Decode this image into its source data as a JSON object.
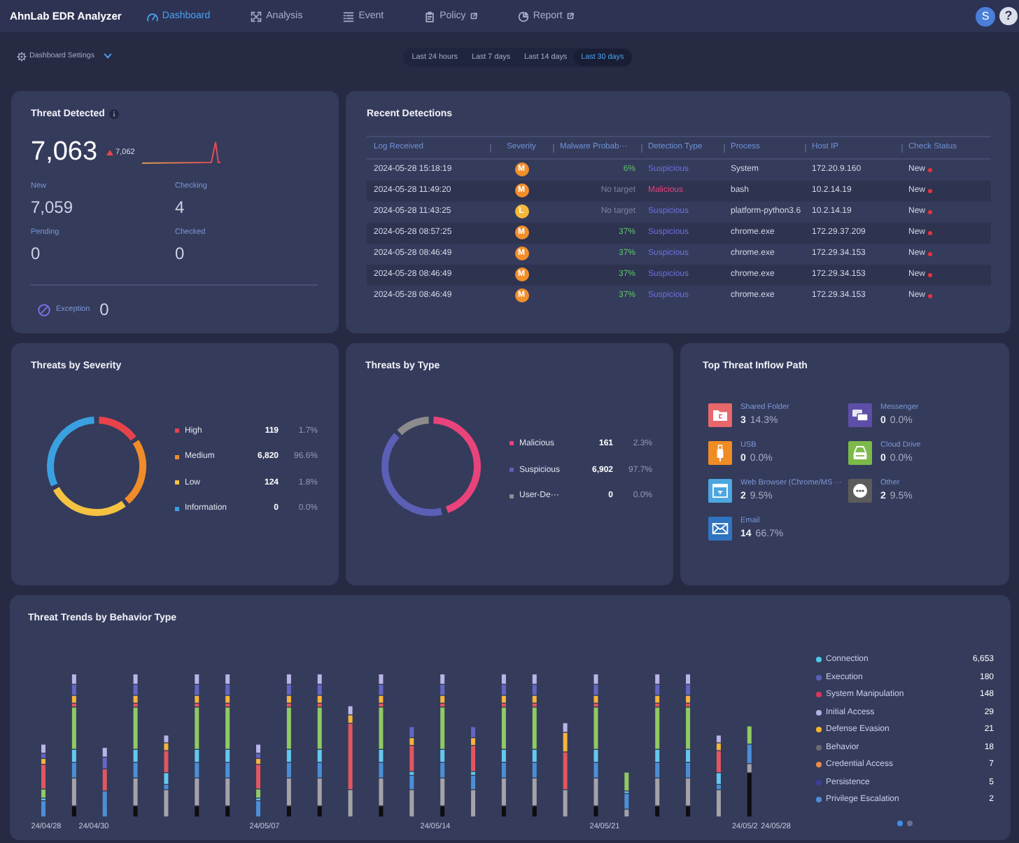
{
  "header": {
    "logo": "AhnLab EDR Analyzer",
    "nav": [
      {
        "label": "Dashboard",
        "kind": "gauge",
        "selected": true,
        "external": false
      },
      {
        "label": "Analysis",
        "kind": "arrows",
        "selected": false,
        "external": false
      },
      {
        "label": "Event",
        "kind": "list",
        "selected": false,
        "external": false
      },
      {
        "label": "Policy",
        "kind": "clipboard",
        "selected": false,
        "external": true
      },
      {
        "label": "Report",
        "kind": "pie",
        "selected": false,
        "external": true
      }
    ],
    "avatar": "S",
    "help": "?"
  },
  "toolbar": {
    "settings": "Dashboard Settings",
    "ranges": [
      {
        "label": "Last 24 hours",
        "selected": false
      },
      {
        "label": "Last 7 days",
        "selected": false
      },
      {
        "label": "Last 14 days",
        "selected": false
      },
      {
        "label": "Last 30 days",
        "selected": true
      }
    ]
  },
  "threat_detected": {
    "title": "Threat Detected",
    "total": "7,063",
    "increased": true,
    "previous": "7,062",
    "stats": [
      {
        "label": "New",
        "value": "7,059"
      },
      {
        "label": "Checking",
        "value": "4"
      },
      {
        "label": "Pending",
        "value": "0"
      },
      {
        "label": "Checked",
        "value": "0"
      }
    ],
    "exception": {
      "label": "Exception",
      "value": "0"
    }
  },
  "recent_detections": {
    "title": "Recent Detections",
    "columns": [
      "Log Received",
      "Severity",
      "Malware Probab···",
      "Detection Type",
      "Process",
      "Host IP",
      "Check Status"
    ],
    "rows": [
      {
        "log_received": "2024-05-28 15:18:19",
        "severity": {
          "letter": "M",
          "color": "#f28f2c"
        },
        "malware_probability": {
          "text": "6%",
          "kind": "percent"
        },
        "detection_type": {
          "text": "Suspicious",
          "kind": "suspicious"
        },
        "process": "System",
        "host_ip": "172.20.9.160",
        "check_status": {
          "text": "New",
          "alert": true
        }
      },
      {
        "log_received": "2024-05-28 11:49:20",
        "severity": {
          "letter": "M",
          "color": "#f28f2c"
        },
        "malware_probability": {
          "text": "No target",
          "kind": "none"
        },
        "detection_type": {
          "text": "Malicious",
          "kind": "malicious"
        },
        "process": "bash",
        "host_ip": "10.2.14.19",
        "check_status": {
          "text": "New",
          "alert": true
        }
      },
      {
        "log_received": "2024-05-28 11:43:25",
        "severity": {
          "letter": "L",
          "color": "#f5b83a"
        },
        "malware_probability": {
          "text": "No target",
          "kind": "none"
        },
        "detection_type": {
          "text": "Suspicious",
          "kind": "suspicious"
        },
        "process": "platform-python3.6",
        "host_ip": "10.2.14.19",
        "check_status": {
          "text": "New",
          "alert": true
        }
      },
      {
        "log_received": "2024-05-28 08:57:25",
        "severity": {
          "letter": "M",
          "color": "#f28f2c"
        },
        "malware_probability": {
          "text": "37%",
          "kind": "percent"
        },
        "detection_type": {
          "text": "Suspicious",
          "kind": "suspicious"
        },
        "process": "chrome.exe",
        "host_ip": "172.29.37.209",
        "check_status": {
          "text": "New",
          "alert": true
        }
      },
      {
        "log_received": "2024-05-28 08:46:49",
        "severity": {
          "letter": "M",
          "color": "#f28f2c"
        },
        "malware_probability": {
          "text": "37%",
          "kind": "percent"
        },
        "detection_type": {
          "text": "Suspicious",
          "kind": "suspicious"
        },
        "process": "chrome.exe",
        "host_ip": "172.29.34.153",
        "check_status": {
          "text": "New",
          "alert": true
        }
      },
      {
        "log_received": "2024-05-28 08:46:49",
        "severity": {
          "letter": "M",
          "color": "#f28f2c"
        },
        "malware_probability": {
          "text": "37%",
          "kind": "percent"
        },
        "detection_type": {
          "text": "Suspicious",
          "kind": "suspicious"
        },
        "process": "chrome.exe",
        "host_ip": "172.29.34.153",
        "check_status": {
          "text": "New",
          "alert": true
        }
      },
      {
        "log_received": "2024-05-28 08:46:49",
        "severity": {
          "letter": "M",
          "color": "#f28f2c"
        },
        "malware_probability": {
          "text": "37%",
          "kind": "percent"
        },
        "detection_type": {
          "text": "Suspicious",
          "kind": "suspicious"
        },
        "process": "chrome.exe",
        "host_ip": "172.29.34.153",
        "check_status": {
          "text": "New",
          "alert": true
        }
      }
    ]
  },
  "threats_by_severity": {
    "title": "Threats by Severity",
    "legend": [
      {
        "label": "High",
        "count": "119",
        "percent": "1.7%",
        "color": "#e8434a"
      },
      {
        "label": "Medium",
        "count": "6,820",
        "percent": "96.6%",
        "color": "#f08c2a"
      },
      {
        "label": "Low",
        "count": "124",
        "percent": "1.8%",
        "color": "#f5c242"
      },
      {
        "label": "Information",
        "count": "0",
        "percent": "0.0%",
        "color": "#3aa0e0"
      }
    ]
  },
  "threats_by_type": {
    "title": "Threats by Type",
    "legend": [
      {
        "label": "Malicious",
        "count": "161",
        "percent": "2.3%",
        "color": "#e8437a"
      },
      {
        "label": "Suspicious",
        "count": "6,902",
        "percent": "97.7%",
        "color": "#5b5fb5"
      },
      {
        "label": "User-De···",
        "count": "0",
        "percent": "0.0%",
        "color": "#8c8c8c"
      }
    ]
  },
  "top_threat_inflow_path": {
    "title": "Top Threat Inflow Path",
    "items": [
      {
        "label": "Shared Folder",
        "count": "3",
        "percent": "14.3%",
        "kind": "folder",
        "color": "#e8676b"
      },
      {
        "label": "Messenger",
        "count": "0",
        "percent": "0.0%",
        "kind": "chat",
        "color": "#5d4fa8"
      },
      {
        "label": "USB",
        "count": "0",
        "percent": "0.0%",
        "kind": "usb",
        "color": "#f08c24"
      },
      {
        "label": "Cloud Drive",
        "count": "0",
        "percent": "0.0%",
        "kind": "drive",
        "color": "#7cba4a"
      },
      {
        "label": "Web Browser (Chrome/MS ···",
        "count": "2",
        "percent": "9.5%",
        "kind": "browser",
        "color": "#4ca6e0"
      },
      {
        "label": "Other",
        "count": "2",
        "percent": "9.5%",
        "kind": "other",
        "color": "#5c5c5c"
      },
      {
        "label": "Email",
        "count": "14",
        "percent": "66.7%",
        "kind": "mail",
        "color": "#2f74c0"
      }
    ]
  },
  "threat_trends": {
    "title": "Threat Trends by Behavior Type",
    "x_labels": [
      "24/04/28",
      "24/04/30",
      "24/05/07",
      "24/05/14",
      "24/05/21",
      "24/05/2",
      "24/05/28"
    ],
    "legend": [
      {
        "label": "Connection",
        "count": "6,653",
        "color": "#4ec6ea"
      },
      {
        "label": "Execution",
        "count": "180",
        "color": "#5a5fb8"
      },
      {
        "label": "System Manipulation",
        "count": "148",
        "color": "#d6375f"
      },
      {
        "label": "Initial Access",
        "count": "29",
        "color": "#b3b1e0"
      },
      {
        "label": "Defense Evasion",
        "count": "21",
        "color": "#f5b52e"
      },
      {
        "label": "Behavior",
        "count": "18",
        "color": "#6b6b6b"
      },
      {
        "label": "Credential Access",
        "count": "7",
        "color": "#f08a4b"
      },
      {
        "label": "Persistence",
        "count": "5",
        "color": "#3a3f9a"
      },
      {
        "label": "Privilege Escalation",
        "count": "2",
        "color": "#4a90d8"
      }
    ],
    "pages": [
      {
        "selected": true
      },
      {
        "selected": false
      }
    ]
  }
}
